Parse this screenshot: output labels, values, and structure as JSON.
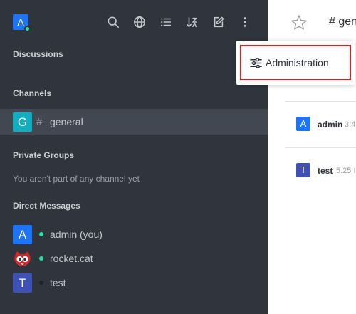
{
  "colors": {
    "sidebar_bg": "#2f343d",
    "active_room_bg": "#414852",
    "online": "#2de0a5",
    "offline": "#1f2329",
    "highlight": "#e02020"
  },
  "user": {
    "avatar_letter": "A"
  },
  "toolbar": {
    "icons": [
      "search-icon",
      "globe-icon",
      "list-icon",
      "sort-icon",
      "edit-icon",
      "kebab-menu-icon"
    ]
  },
  "sidebar": {
    "discussions_title": "Discussions",
    "channels_title": "Channels",
    "channels": [
      {
        "letter": "G",
        "name": "general",
        "color": "#10aebf"
      }
    ],
    "private_groups_title": "Private Groups",
    "private_groups_empty": "You aren't part of any channel yet",
    "direct_messages_title": "Direct Messages",
    "direct_messages": [
      {
        "letter": "A",
        "name": "admin (you)",
        "status": "online",
        "color": "#1d74f5"
      },
      {
        "letter": "",
        "name": "rocket.cat",
        "status": "online",
        "color": "#cc2a2a"
      },
      {
        "letter": "T",
        "name": "test",
        "status": "offline",
        "color": "#3f51b5"
      }
    ]
  },
  "main": {
    "room_title": "gen",
    "messages": [
      {
        "letter": "A",
        "user": "admin",
        "time": "3:4",
        "color": "#1d74f5"
      },
      {
        "letter": "T",
        "user": "test",
        "time": "5:25 I",
        "color": "#3f51b5"
      }
    ]
  },
  "menu": {
    "administration_label": "Administration"
  }
}
